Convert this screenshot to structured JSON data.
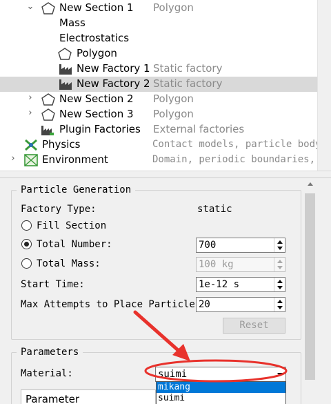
{
  "tree": {
    "items": [
      {
        "label": "New Section 1",
        "desc": "Polygon"
      },
      {
        "label": "Mass",
        "desc": ""
      },
      {
        "label": "Electrostatics",
        "desc": ""
      },
      {
        "label": "Polygon",
        "desc": ""
      },
      {
        "label": "New Factory 1",
        "desc": "Static factory"
      },
      {
        "label": "New Factory 2",
        "desc": "Static factory"
      },
      {
        "label": "New Section 2",
        "desc": "Polygon"
      },
      {
        "label": "New Section 3",
        "desc": "Polygon"
      },
      {
        "label": "Plugin Factories",
        "desc": "External factories"
      },
      {
        "label": "Physics",
        "desc": "Contact models, particle body-"
      },
      {
        "label": "Environment",
        "desc": "Domain, periodic boundaries, t"
      }
    ]
  },
  "particle_generation": {
    "title": "Particle Generation",
    "factory_type_label": "Factory Type:",
    "factory_type_value": "static",
    "fill_section_label": "Fill Section",
    "total_number_label": "Total Number:",
    "total_number_value": "700",
    "total_mass_label": "Total Mass:",
    "total_mass_value": "100 kg",
    "start_time_label": "Start Time:",
    "start_time_value": "1e-12 s",
    "max_attempts_label": "Max Attempts to Place Particle:",
    "max_attempts_value": "20",
    "reset_label": "Reset"
  },
  "parameters": {
    "title": "Parameters",
    "material_label": "Material:",
    "material_value": "suimi",
    "material_options": [
      "mikang",
      "suimi"
    ],
    "table_header": "Parameter"
  },
  "colors": {
    "selection": "#d9d9d9",
    "highlight": "#0078d7",
    "annotation": "#e8322c"
  }
}
